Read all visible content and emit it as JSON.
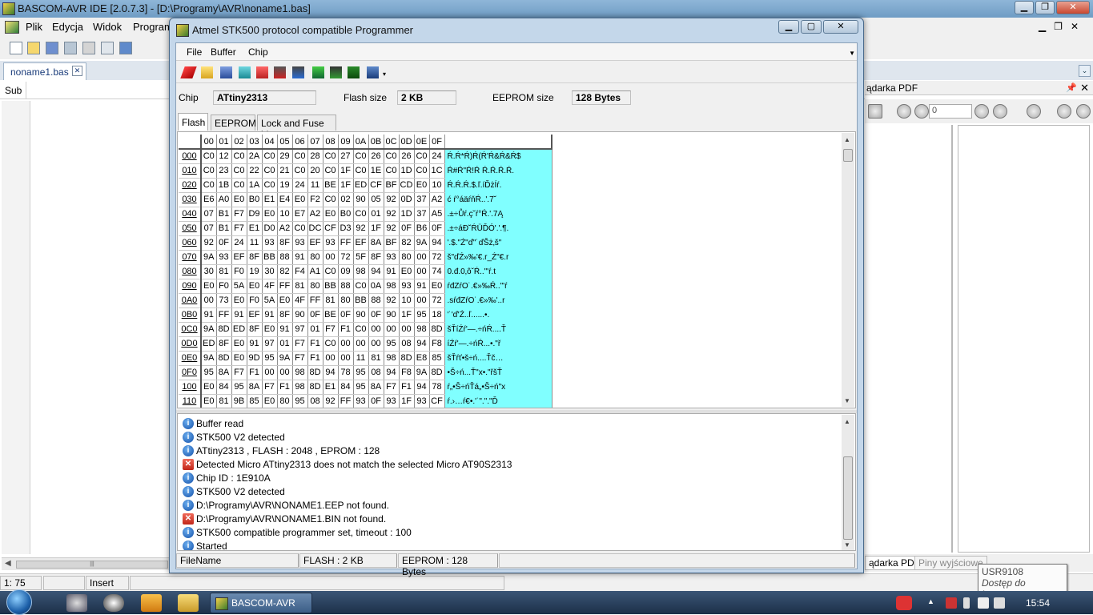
{
  "ide": {
    "title": "BASCOM-AVR IDE [2.0.7.3] - [D:\\Programy\\AVR\\noname1.bas]",
    "menu": [
      "Plik",
      "Edycja",
      "Widok",
      "Program"
    ],
    "doc_tab": "noname1.bas",
    "sub_label": "Sub",
    "pdf_panel_title": "ądarka PDF",
    "pdf_page_value": "0",
    "bottom_tabs": [
      "ądarka PDF",
      "Piny wyjściowe"
    ],
    "status": {
      "position": "1: 75",
      "mode": "Insert"
    }
  },
  "tooltip": {
    "line1": "USR9108",
    "line2": "Dostęp do Internetu"
  },
  "taskbar": {
    "app_label": "BASCOM-AVR",
    "time": "15:54"
  },
  "dialog": {
    "title": "Atmel STK500 protocol compatible Programmer",
    "menu": [
      "File",
      "Buffer",
      "Chip"
    ],
    "chip_label": "Chip",
    "chip_value": "ATtiny2313",
    "flash_label": "Flash size",
    "flash_value": "2 KB",
    "eeprom_label": "EEPROM size",
    "eeprom_value": "128 Bytes",
    "tabs": [
      "Flash",
      "EEPROM",
      "Lock and Fuse bits"
    ],
    "active_tab": "Flash",
    "hex": {
      "columns": [
        "00",
        "01",
        "02",
        "03",
        "04",
        "05",
        "06",
        "07",
        "08",
        "09",
        "0A",
        "0B",
        "0C",
        "0D",
        "0E",
        "0F"
      ],
      "rows": [
        {
          "addr": "000",
          "bytes": [
            "C0",
            "12",
            "C0",
            "2A",
            "C0",
            "29",
            "C0",
            "28",
            "C0",
            "27",
            "C0",
            "26",
            "C0",
            "26",
            "C0",
            "24"
          ],
          "ascii": "Ŕ.Ŕ*Ŕ)Ŕ(Ŕ'Ŕ&Ŕ&Ŕ$"
        },
        {
          "addr": "010",
          "bytes": [
            "C0",
            "23",
            "C0",
            "22",
            "C0",
            "21",
            "C0",
            "20",
            "C0",
            "1F",
            "C0",
            "1E",
            "C0",
            "1D",
            "C0",
            "1C"
          ],
          "ascii": "Ŕ#Ŕ\"Ŕ!Ŕ Ŕ.Ŕ.Ŕ.Ŕ."
        },
        {
          "addr": "020",
          "bytes": [
            "C0",
            "1B",
            "C0",
            "1A",
            "C0",
            "19",
            "24",
            "11",
            "BE",
            "1F",
            "ED",
            "CF",
            "BF",
            "CD",
            "E0",
            "10"
          ],
          "ascii": "Ŕ.Ŕ.Ŕ.$.ľ.íĎżÍŕ."
        },
        {
          "addr": "030",
          "bytes": [
            "E6",
            "A0",
            "E0",
            "B0",
            "E1",
            "E4",
            "E0",
            "F2",
            "C0",
            "02",
            "90",
            "05",
            "92",
            "0D",
            "37",
            "A2"
          ],
          "ascii": "ć ŕ°áäŕňŔ..'.7˘"
        },
        {
          "addr": "040",
          "bytes": [
            "07",
            "B1",
            "F7",
            "D9",
            "E0",
            "10",
            "E7",
            "A2",
            "E0",
            "B0",
            "C0",
            "01",
            "92",
            "1D",
            "37",
            "A5"
          ],
          "ascii": ".±÷Ůŕ.ç˘ŕ°Ŕ.'.7Ą"
        },
        {
          "addr": "050",
          "bytes": [
            "07",
            "B1",
            "F7",
            "E1",
            "D0",
            "A2",
            "C0",
            "DC",
            "CF",
            "D3",
            "92",
            "1F",
            "92",
            "0F",
            "B6",
            "0F"
          ],
          "ascii": ".±÷áĐ˘ŔÜĎÓ'.'.¶."
        },
        {
          "addr": "060",
          "bytes": [
            "92",
            "0F",
            "24",
            "11",
            "93",
            "8F",
            "93",
            "EF",
            "93",
            "FF",
            "EF",
            "8A",
            "BF",
            "82",
            "9A",
            "94"
          ],
          "ascii": "'.$.\"Ź\"ď\"˙ďŠż‚š\""
        },
        {
          "addr": "070",
          "bytes": [
            "9A",
            "93",
            "EF",
            "8F",
            "BB",
            "88",
            "91",
            "80",
            "00",
            "72",
            "5F",
            "8F",
            "93",
            "80",
            "00",
            "72"
          ],
          "ascii": "š\"ďŹ»‰'€.r_Ź\"€.r"
        },
        {
          "addr": "080",
          "bytes": [
            "30",
            "81",
            "F0",
            "19",
            "30",
            "82",
            "F4",
            "A1",
            "C0",
            "09",
            "98",
            "94",
            "91",
            "E0",
            "00",
            "74"
          ],
          "ascii": "0.đ.0‚ôˇŔ..\"'ŕ.t"
        },
        {
          "addr": "090",
          "bytes": [
            "E0",
            "F0",
            "5A",
            "E0",
            "4F",
            "FF",
            "81",
            "80",
            "BB",
            "88",
            "C0",
            "0A",
            "98",
            "93",
            "91",
            "E0"
          ],
          "ascii": "ŕđZŕO˙.€»‰Ŕ..\"'ŕ"
        },
        {
          "addr": "0A0",
          "bytes": [
            "00",
            "73",
            "E0",
            "F0",
            "5A",
            "E0",
            "4F",
            "FF",
            "81",
            "80",
            "BB",
            "88",
            "92",
            "10",
            "00",
            "72"
          ],
          "ascii": ".sŕđZŕO˙.€»‰'..r"
        },
        {
          "addr": "0B0",
          "bytes": [
            "91",
            "FF",
            "91",
            "EF",
            "91",
            "8F",
            "90",
            "0F",
            "BE",
            "0F",
            "90",
            "0F",
            "90",
            "1F",
            "95",
            "18"
          ],
          "ascii": "'˙'ď'Ź..ľ......•."
        },
        {
          "addr": "0C0",
          "bytes": [
            "9A",
            "8D",
            "ED",
            "8F",
            "E0",
            "91",
            "97",
            "01",
            "F7",
            "F1",
            "C0",
            "00",
            "00",
            "00",
            "98",
            "8D"
          ],
          "ascii": "šŤíŹŕ'—.÷ńŔ....Ť"
        },
        {
          "addr": "0D0",
          "bytes": [
            "ED",
            "8F",
            "E0",
            "91",
            "97",
            "01",
            "F7",
            "F1",
            "C0",
            "00",
            "00",
            "00",
            "95",
            "08",
            "94",
            "F8"
          ],
          "ascii": "íŹŕ'—.÷ńŔ...•.\"ř"
        },
        {
          "addr": "0E0",
          "bytes": [
            "9A",
            "8D",
            "E0",
            "9D",
            "95",
            "9A",
            "F7",
            "F1",
            "00",
            "00",
            "11",
            "81",
            "98",
            "8D",
            "E8",
            "85"
          ],
          "ascii": "šŤŕť•š÷ń....Ťč…"
        },
        {
          "addr": "0F0",
          "bytes": [
            "95",
            "8A",
            "F7",
            "F1",
            "00",
            "00",
            "98",
            "8D",
            "94",
            "78",
            "95",
            "08",
            "94",
            "F8",
            "9A",
            "8D"
          ],
          "ascii": "•Š÷ń...Ť\"x•.\"řšŤ"
        },
        {
          "addr": "100",
          "bytes": [
            "E0",
            "84",
            "95",
            "8A",
            "F7",
            "F1",
            "98",
            "8D",
            "E1",
            "84",
            "95",
            "8A",
            "F7",
            "F1",
            "94",
            "78"
          ],
          "ascii": "ŕ„•Š÷ńŤá„•Š÷ń\"x"
        },
        {
          "addr": "110",
          "bytes": [
            "E0",
            "81",
            "9B",
            "85",
            "E0",
            "80",
            "95",
            "08",
            "92",
            "FF",
            "93",
            "0F",
            "93",
            "1F",
            "93",
            "CF"
          ],
          "ascii": "ŕ.›…ŕ€•.'˙\".\".\"Ď"
        }
      ]
    },
    "log": [
      {
        "type": "info",
        "text": "Buffer read"
      },
      {
        "type": "info",
        "text": "STK500 V2 detected"
      },
      {
        "type": "info",
        "text": "ATtiny2313 , FLASH : 2048 , EPROM : 128"
      },
      {
        "type": "error",
        "text": "Detected Micro ATtiny2313 does not match the selected Micro AT90S2313"
      },
      {
        "type": "info",
        "text": "Chip ID : 1E910A"
      },
      {
        "type": "info",
        "text": "STK500 V2 detected"
      },
      {
        "type": "info",
        "text": "D:\\Programy\\AVR\\NONAME1.EEP not found."
      },
      {
        "type": "error",
        "text": "D:\\Programy\\AVR\\NONAME1.BIN not found."
      },
      {
        "type": "info",
        "text": "STK500 compatible programmer set, timeout : 100"
      },
      {
        "type": "info",
        "text": "Started"
      }
    ],
    "status": {
      "filename": "FileName",
      "flash": "FLASH : 2 KB",
      "eeprom": "EEPROM : 128 Bytes"
    }
  }
}
